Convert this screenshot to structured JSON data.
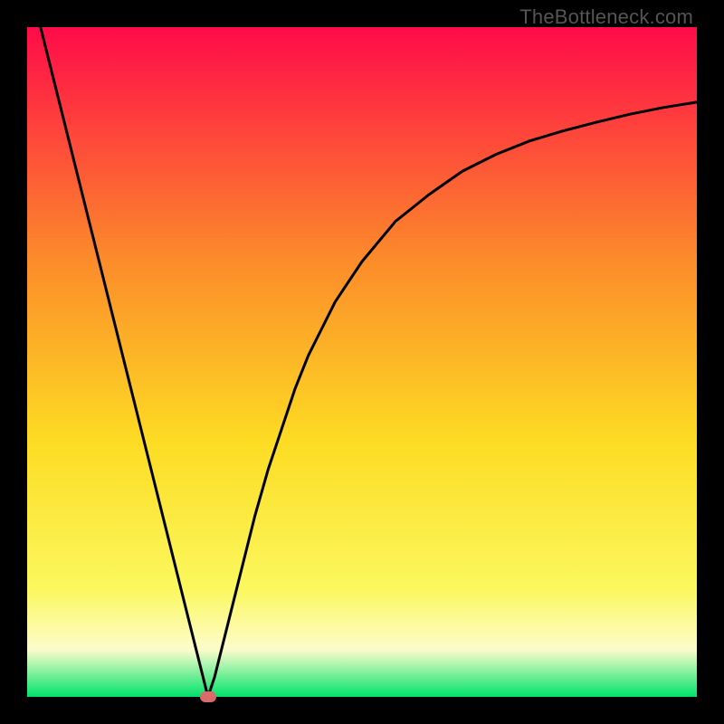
{
  "watermark": "TheBottleneck.com",
  "chart_data": {
    "type": "line",
    "title": "",
    "xlabel": "",
    "ylabel": "",
    "xlim": [
      0,
      100
    ],
    "ylim": [
      0,
      100
    ],
    "grid": false,
    "legend": false,
    "background_gradient": {
      "top": "#ff0b49",
      "mid_upper": "#fc8c2a",
      "mid": "#fddc23",
      "mid_lower": "#fbf85f",
      "band": "#fcfccc",
      "bottom": "#00e36b"
    },
    "marker": {
      "x": 27,
      "y": 0,
      "color": "#d96b6b"
    },
    "series": [
      {
        "name": "curve",
        "x": [
          2,
          4,
          6,
          8,
          10,
          12,
          14,
          16,
          18,
          20,
          22,
          24,
          26,
          27,
          28,
          30,
          32,
          34,
          36,
          38,
          40,
          42,
          44,
          46,
          48,
          50,
          55,
          60,
          65,
          70,
          75,
          80,
          85,
          90,
          95,
          100
        ],
        "y": [
          100,
          92,
          84,
          76,
          68,
          60,
          52,
          44,
          36,
          28,
          20,
          12,
          4,
          0,
          3,
          11,
          19,
          27,
          34,
          40,
          46,
          51,
          55,
          59,
          62,
          65,
          71,
          75,
          78.5,
          81,
          83,
          84.5,
          85.8,
          87,
          88,
          88.8
        ]
      }
    ]
  }
}
